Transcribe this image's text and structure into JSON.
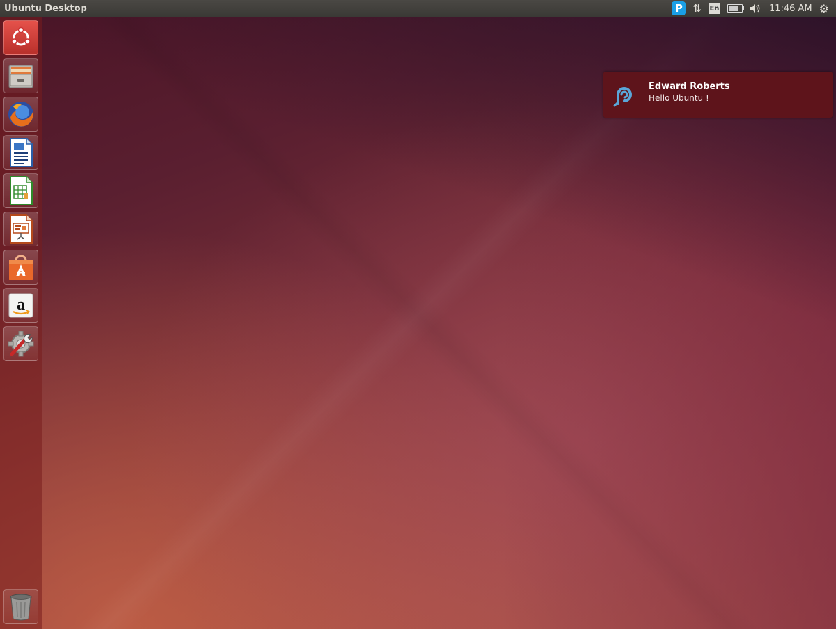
{
  "panel": {
    "title": "Ubuntu Desktop",
    "clock": "11:46 AM",
    "keyboard_layout": "En",
    "pushbullet_glyph": "P",
    "network_glyph": "⇅",
    "volume_glyph": "◀)",
    "settings_glyph": "⚙",
    "battery_level": 0.75
  },
  "launcher": {
    "items": [
      {
        "name": "Dash home",
        "icon": "ubuntu-logo-icon"
      },
      {
        "name": "Files",
        "icon": "file-cabinet-icon"
      },
      {
        "name": "Firefox Web Browser",
        "icon": "firefox-icon"
      },
      {
        "name": "LibreOffice Writer",
        "icon": "writer-icon"
      },
      {
        "name": "LibreOffice Calc",
        "icon": "calc-icon"
      },
      {
        "name": "LibreOffice Impress",
        "icon": "impress-icon"
      },
      {
        "name": "Ubuntu Software Center",
        "icon": "software-center-icon"
      },
      {
        "name": "Amazon",
        "icon": "amazon-icon"
      },
      {
        "name": "System Settings",
        "icon": "settings-wrench-icon"
      },
      {
        "name": "Trash",
        "icon": "trash-icon"
      }
    ]
  },
  "notification": {
    "title": "Edward Roberts",
    "body": "Hello Ubuntu !",
    "icon": "pushbullet-pin-icon"
  },
  "colors": {
    "panel_bg": "#3c3b37",
    "notification_bg": "#5e141b",
    "pushbullet_blue": "#1a9fe6"
  }
}
